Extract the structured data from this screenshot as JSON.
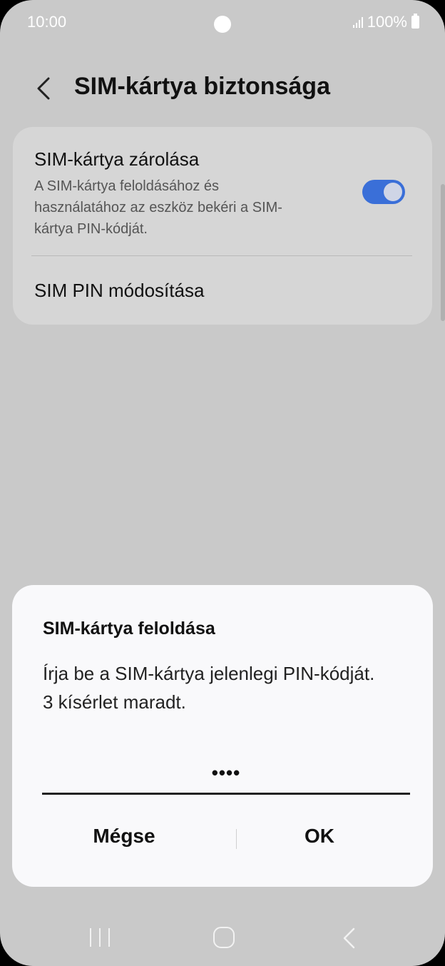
{
  "status_bar": {
    "time": "10:00",
    "battery": "100%"
  },
  "header": {
    "title": "SIM-kártya biztonsága"
  },
  "settings": {
    "lock": {
      "title": "SIM-kártya zárolása",
      "description": "A SIM-kártya feloldásához és használatához az eszköz bekéri a SIM-kártya PIN-kódját.",
      "enabled": true
    },
    "change_pin": {
      "title": "SIM PIN módosítása"
    }
  },
  "dialog": {
    "title": "SIM-kártya feloldása",
    "line1": "Írja be a SIM-kártya jelenlegi PIN-kódját.",
    "line2": "3 kísérlet maradt.",
    "pin_value": "••••",
    "cancel_label": "Mégse",
    "ok_label": "OK"
  },
  "colors": {
    "accent": "#3a6fd8",
    "background": "#c9c9c9",
    "card": "#d6d6d6",
    "dialog": "#f9f9fb"
  },
  "icons": {
    "back": "chevron-left-icon",
    "recents": "recents-icon",
    "home": "home-icon",
    "nav_back": "back-icon"
  }
}
